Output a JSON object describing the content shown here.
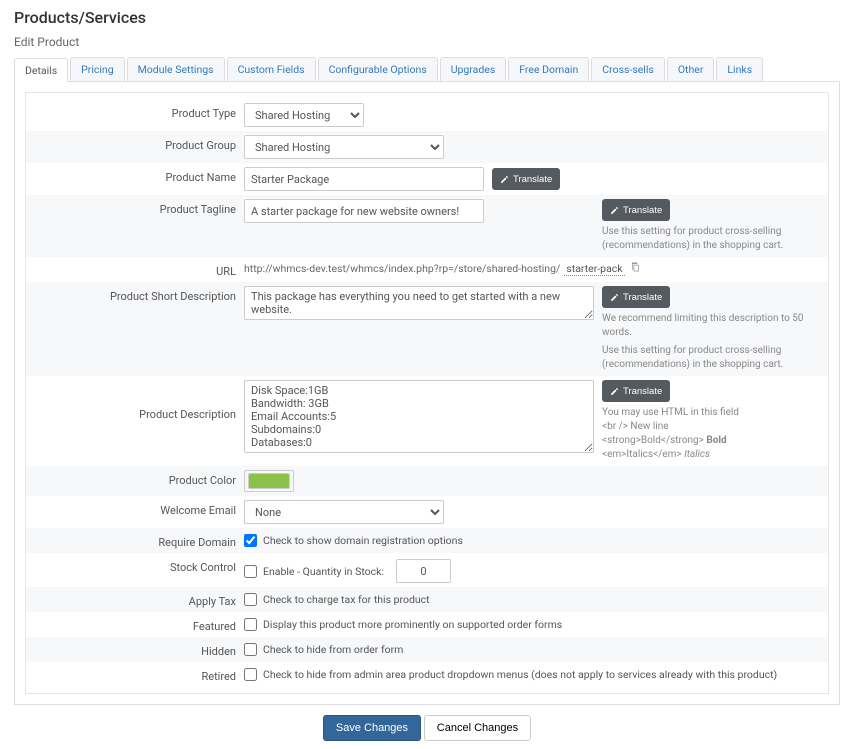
{
  "page": {
    "title": "Products/Services",
    "subtitle": "Edit Product"
  },
  "tabs": [
    "Details",
    "Pricing",
    "Module Settings",
    "Custom Fields",
    "Configurable Options",
    "Upgrades",
    "Free Domain",
    "Cross-sells",
    "Other",
    "Links"
  ],
  "labels": {
    "product_type": "Product Type",
    "product_group": "Product Group",
    "product_name": "Product Name",
    "product_tagline": "Product Tagline",
    "url": "URL",
    "short_desc": "Product Short Description",
    "description": "Product Description",
    "color": "Product Color",
    "welcome_email": "Welcome Email",
    "require_domain": "Require Domain",
    "stock_control": "Stock Control",
    "apply_tax": "Apply Tax",
    "featured": "Featured",
    "hidden": "Hidden",
    "retired": "Retired"
  },
  "fields": {
    "product_type": "Shared Hosting",
    "product_group": "Shared Hosting",
    "product_name": "Starter Package",
    "product_tagline": "A starter package for new website owners!",
    "url_base": "http://whmcs-dev.test/whmcs/index.php?rp=/store/shared-hosting/",
    "url_slug": "starter-pack",
    "short_desc": "This package has everything you need to get started with a new website.",
    "description": "Disk Space:1GB\nBandwidth: 3GB\nEmail Accounts:5\nSubdomains:0\nDatabases:0",
    "color": "#8bc34a",
    "welcome_email": "None",
    "require_domain_checked": true,
    "require_domain_label": "Check to show domain registration options",
    "stock_control_checked": false,
    "stock_control_label": "Enable - Quantity in Stock:",
    "stock_qty": "0",
    "apply_tax_checked": false,
    "apply_tax_label": "Check to charge tax for this product",
    "featured_checked": false,
    "featured_label": "Display this product more prominently on supported order forms",
    "hidden_checked": false,
    "hidden_label": "Check to hide from order form",
    "retired_checked": false,
    "retired_label": "Check to hide from admin area product dropdown menus (does not apply to services already with this product)"
  },
  "help": {
    "tagline": "Use this setting for product cross-selling (recommendations) in the shopping cart.",
    "short1": "We recommend limiting this description to 50 words.",
    "short2": "Use this setting for product cross-selling (recommendations) in the shopping cart.",
    "desc1": "You may use HTML in this field",
    "desc_br": "<br /> New line",
    "desc_strong_raw": "<strong>Bold</strong> ",
    "desc_strong_ex": "Bold",
    "desc_em_raw": "<em>Italics</em> ",
    "desc_em_ex": "Italics"
  },
  "buttons": {
    "translate": "Translate",
    "save": "Save Changes",
    "cancel": "Cancel Changes"
  }
}
